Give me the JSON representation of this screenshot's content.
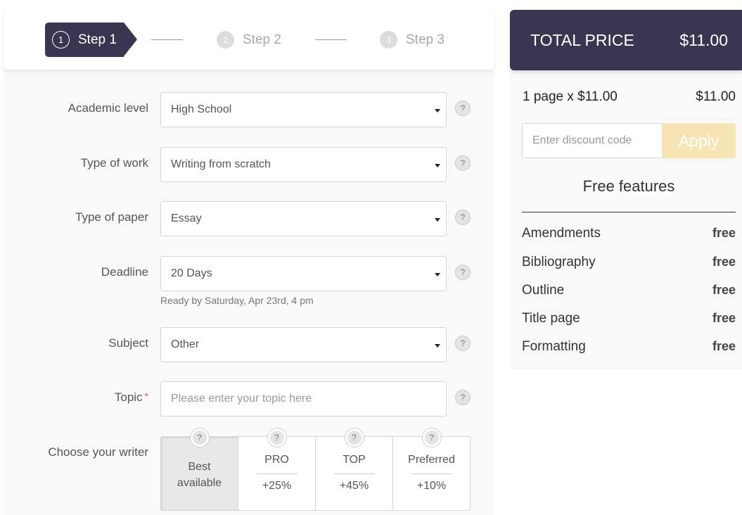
{
  "steps": [
    {
      "number": "1",
      "label": "Step 1",
      "active": true
    },
    {
      "number": "2",
      "label": "Step 2",
      "active": false
    },
    {
      "number": "3",
      "label": "Step 3",
      "active": false
    }
  ],
  "form": {
    "academic_level": {
      "label": "Academic level",
      "value": "High School",
      "help": "?"
    },
    "type_of_work": {
      "label": "Type of work",
      "value": "Writing from scratch",
      "help": "?"
    },
    "type_of_paper": {
      "label": "Type of paper",
      "value": "Essay",
      "help": "?"
    },
    "deadline": {
      "label": "Deadline",
      "value": "20 Days",
      "hint": "Ready by Saturday, Apr 23rd, 4 pm",
      "help": "?"
    },
    "subject": {
      "label": "Subject",
      "value": "Other",
      "help": "?"
    },
    "topic": {
      "label": "Topic",
      "required_mark": "*",
      "value": "",
      "placeholder": "Please enter your topic here",
      "help": "?"
    },
    "writer": {
      "label": "Choose your writer",
      "options": [
        {
          "name": "Best available",
          "line1": "Best",
          "line2": "available",
          "selected": true,
          "help": "?"
        },
        {
          "name": "PRO",
          "surcharge": "+25%",
          "selected": false,
          "help": "?"
        },
        {
          "name": "TOP",
          "surcharge": "+45%",
          "selected": false,
          "help": "?"
        },
        {
          "name": "Preferred",
          "surcharge": "+10%",
          "selected": false,
          "help": "?"
        }
      ]
    }
  },
  "summary": {
    "total_label": "TOTAL PRICE",
    "total_value": "$11.00",
    "line_item": "1 page x $11.00",
    "line_total": "$11.00",
    "discount_placeholder": "Enter discount code",
    "discount_value": "",
    "apply_label": "Apply",
    "features_title": "Free features",
    "features": [
      {
        "name": "Amendments",
        "price": "free"
      },
      {
        "name": "Bibliography",
        "price": "free"
      },
      {
        "name": "Outline",
        "price": "free"
      },
      {
        "name": "Title page",
        "price": "free"
      },
      {
        "name": "Formatting",
        "price": "free"
      }
    ]
  },
  "colors": {
    "brand_dark": "#3b3551",
    "apply_button": "#f6e4b4",
    "required": "#d9534f",
    "panel_bg": "#f9f9f9"
  }
}
